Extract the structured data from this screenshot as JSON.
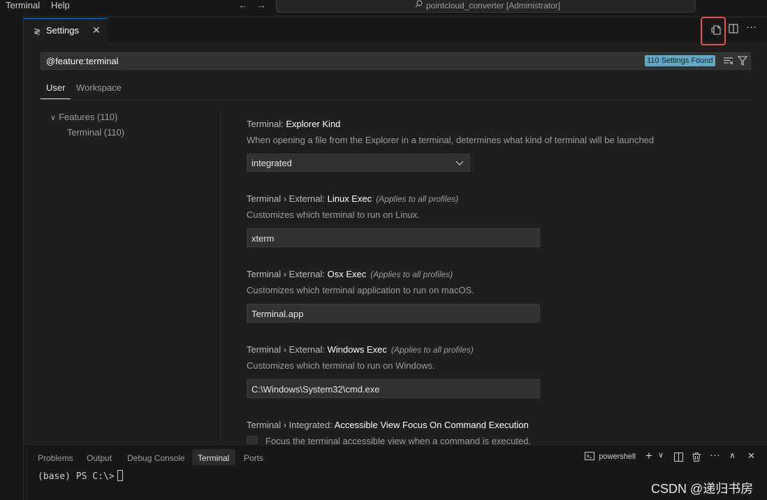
{
  "menu": [
    "Terminal",
    "Help"
  ],
  "command_center": {
    "text": "pointcloud_converter [Administrator]"
  },
  "editor_tab": {
    "label": "Settings"
  },
  "search": {
    "value": "@feature:terminal",
    "results_badge": "110 Settings Found"
  },
  "scope_tabs": [
    "User",
    "Workspace"
  ],
  "toc": {
    "features": "Features (110)",
    "terminal": "Terminal (110)"
  },
  "settings": [
    {
      "prefix": "Terminal: ",
      "name": "Explorer Kind",
      "applies": "",
      "description": "When opening a file from the Explorer in a terminal, determines what kind of terminal will be launched",
      "value": "integrated"
    },
    {
      "prefix": "Terminal › External: ",
      "name": "Linux Exec",
      "applies": "(Applies to all profiles)",
      "description": "Customizes which terminal to run on Linux.",
      "value": "xterm"
    },
    {
      "prefix": "Terminal › External: ",
      "name": "Osx Exec",
      "applies": "(Applies to all profiles)",
      "description": "Customizes which terminal application to run on macOS.",
      "value": "Terminal.app"
    },
    {
      "prefix": "Terminal › External: ",
      "name": "Windows Exec",
      "applies": "(Applies to all profiles)",
      "description": "Customizes which terminal to run on Windows.",
      "value": "C:\\Windows\\System32\\cmd.exe"
    },
    {
      "prefix": "Terminal › Integrated: ",
      "name": "Accessible View Focus On Command Execution",
      "applies": "",
      "description": "Focus the terminal accessible view when a command is executed."
    }
  ],
  "panel": {
    "tabs": [
      "Problems",
      "Output",
      "Debug Console",
      "Terminal",
      "Ports"
    ],
    "shell": "powershell",
    "prompt": "(base) PS C:\\>"
  },
  "watermark": "CSDN @递归书房",
  "colors": {
    "accent": "#0078d4",
    "highlight_box": "#e05252",
    "badge": "#5fa8c6"
  }
}
